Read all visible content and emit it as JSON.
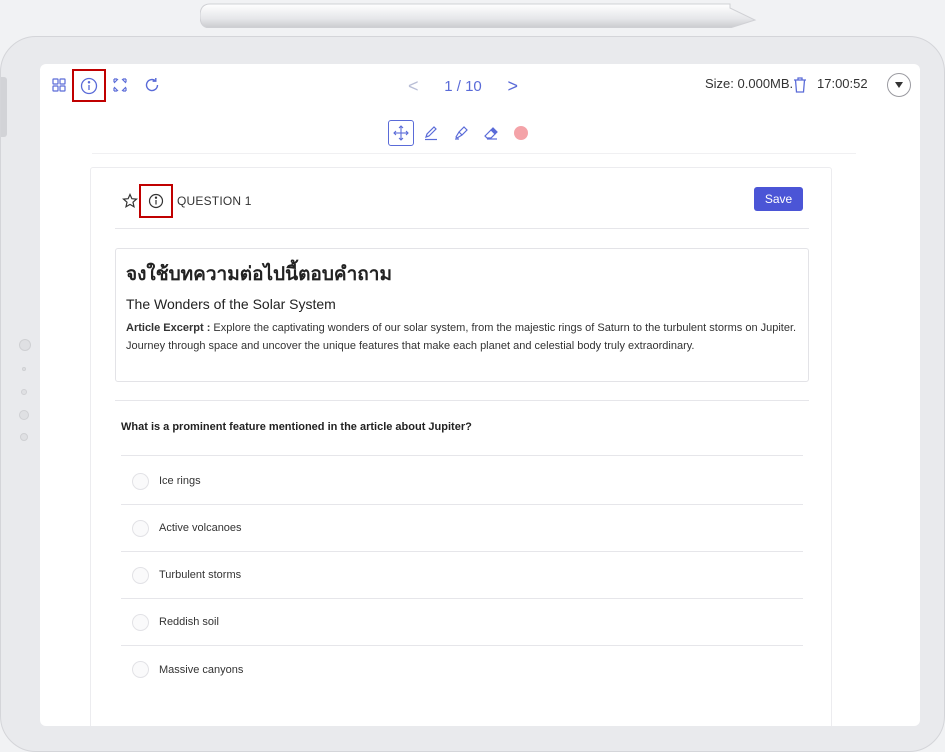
{
  "toolbar": {
    "page_current": "1",
    "page_separator": "/",
    "page_total": "10",
    "size_text": "Size: 0.000MB.",
    "time_text": "17:00:52",
    "icons": [
      "grid-icon",
      "info-icon",
      "fullscreen-icon",
      "refresh-icon",
      "trash-icon",
      "chevron-down-icon"
    ],
    "accent_color": "#5a6bd8"
  },
  "drawing_tools": {
    "icons": [
      "move-icon",
      "pen-icon",
      "highlighter-icon",
      "eraser-icon",
      "color-swatch"
    ],
    "swatch_color": "#f4a3a8"
  },
  "question": {
    "title": "QUESTION 1",
    "save_label": "Save",
    "save_color": "#4b55d6"
  },
  "article": {
    "heading": "จงใช้บทความต่อไปนี้ตอบคำถาม",
    "subheading": "The Wonders of the Solar System",
    "excerpt_label": "Article Excerpt :",
    "excerpt_text": " Explore the captivating wonders of our solar system, from the majestic rings of Saturn to the turbulent storms on Jupiter. Journey through space and uncover the unique features that make each planet and celestial body truly extraordinary."
  },
  "prompt": "What is a prominent feature mentioned in the article about Jupiter?",
  "options": [
    {
      "label": "Ice rings"
    },
    {
      "label": "Active volcanoes"
    },
    {
      "label": "Turbulent storms"
    },
    {
      "label": "Reddish soil"
    },
    {
      "label": "Massive canyons"
    }
  ]
}
